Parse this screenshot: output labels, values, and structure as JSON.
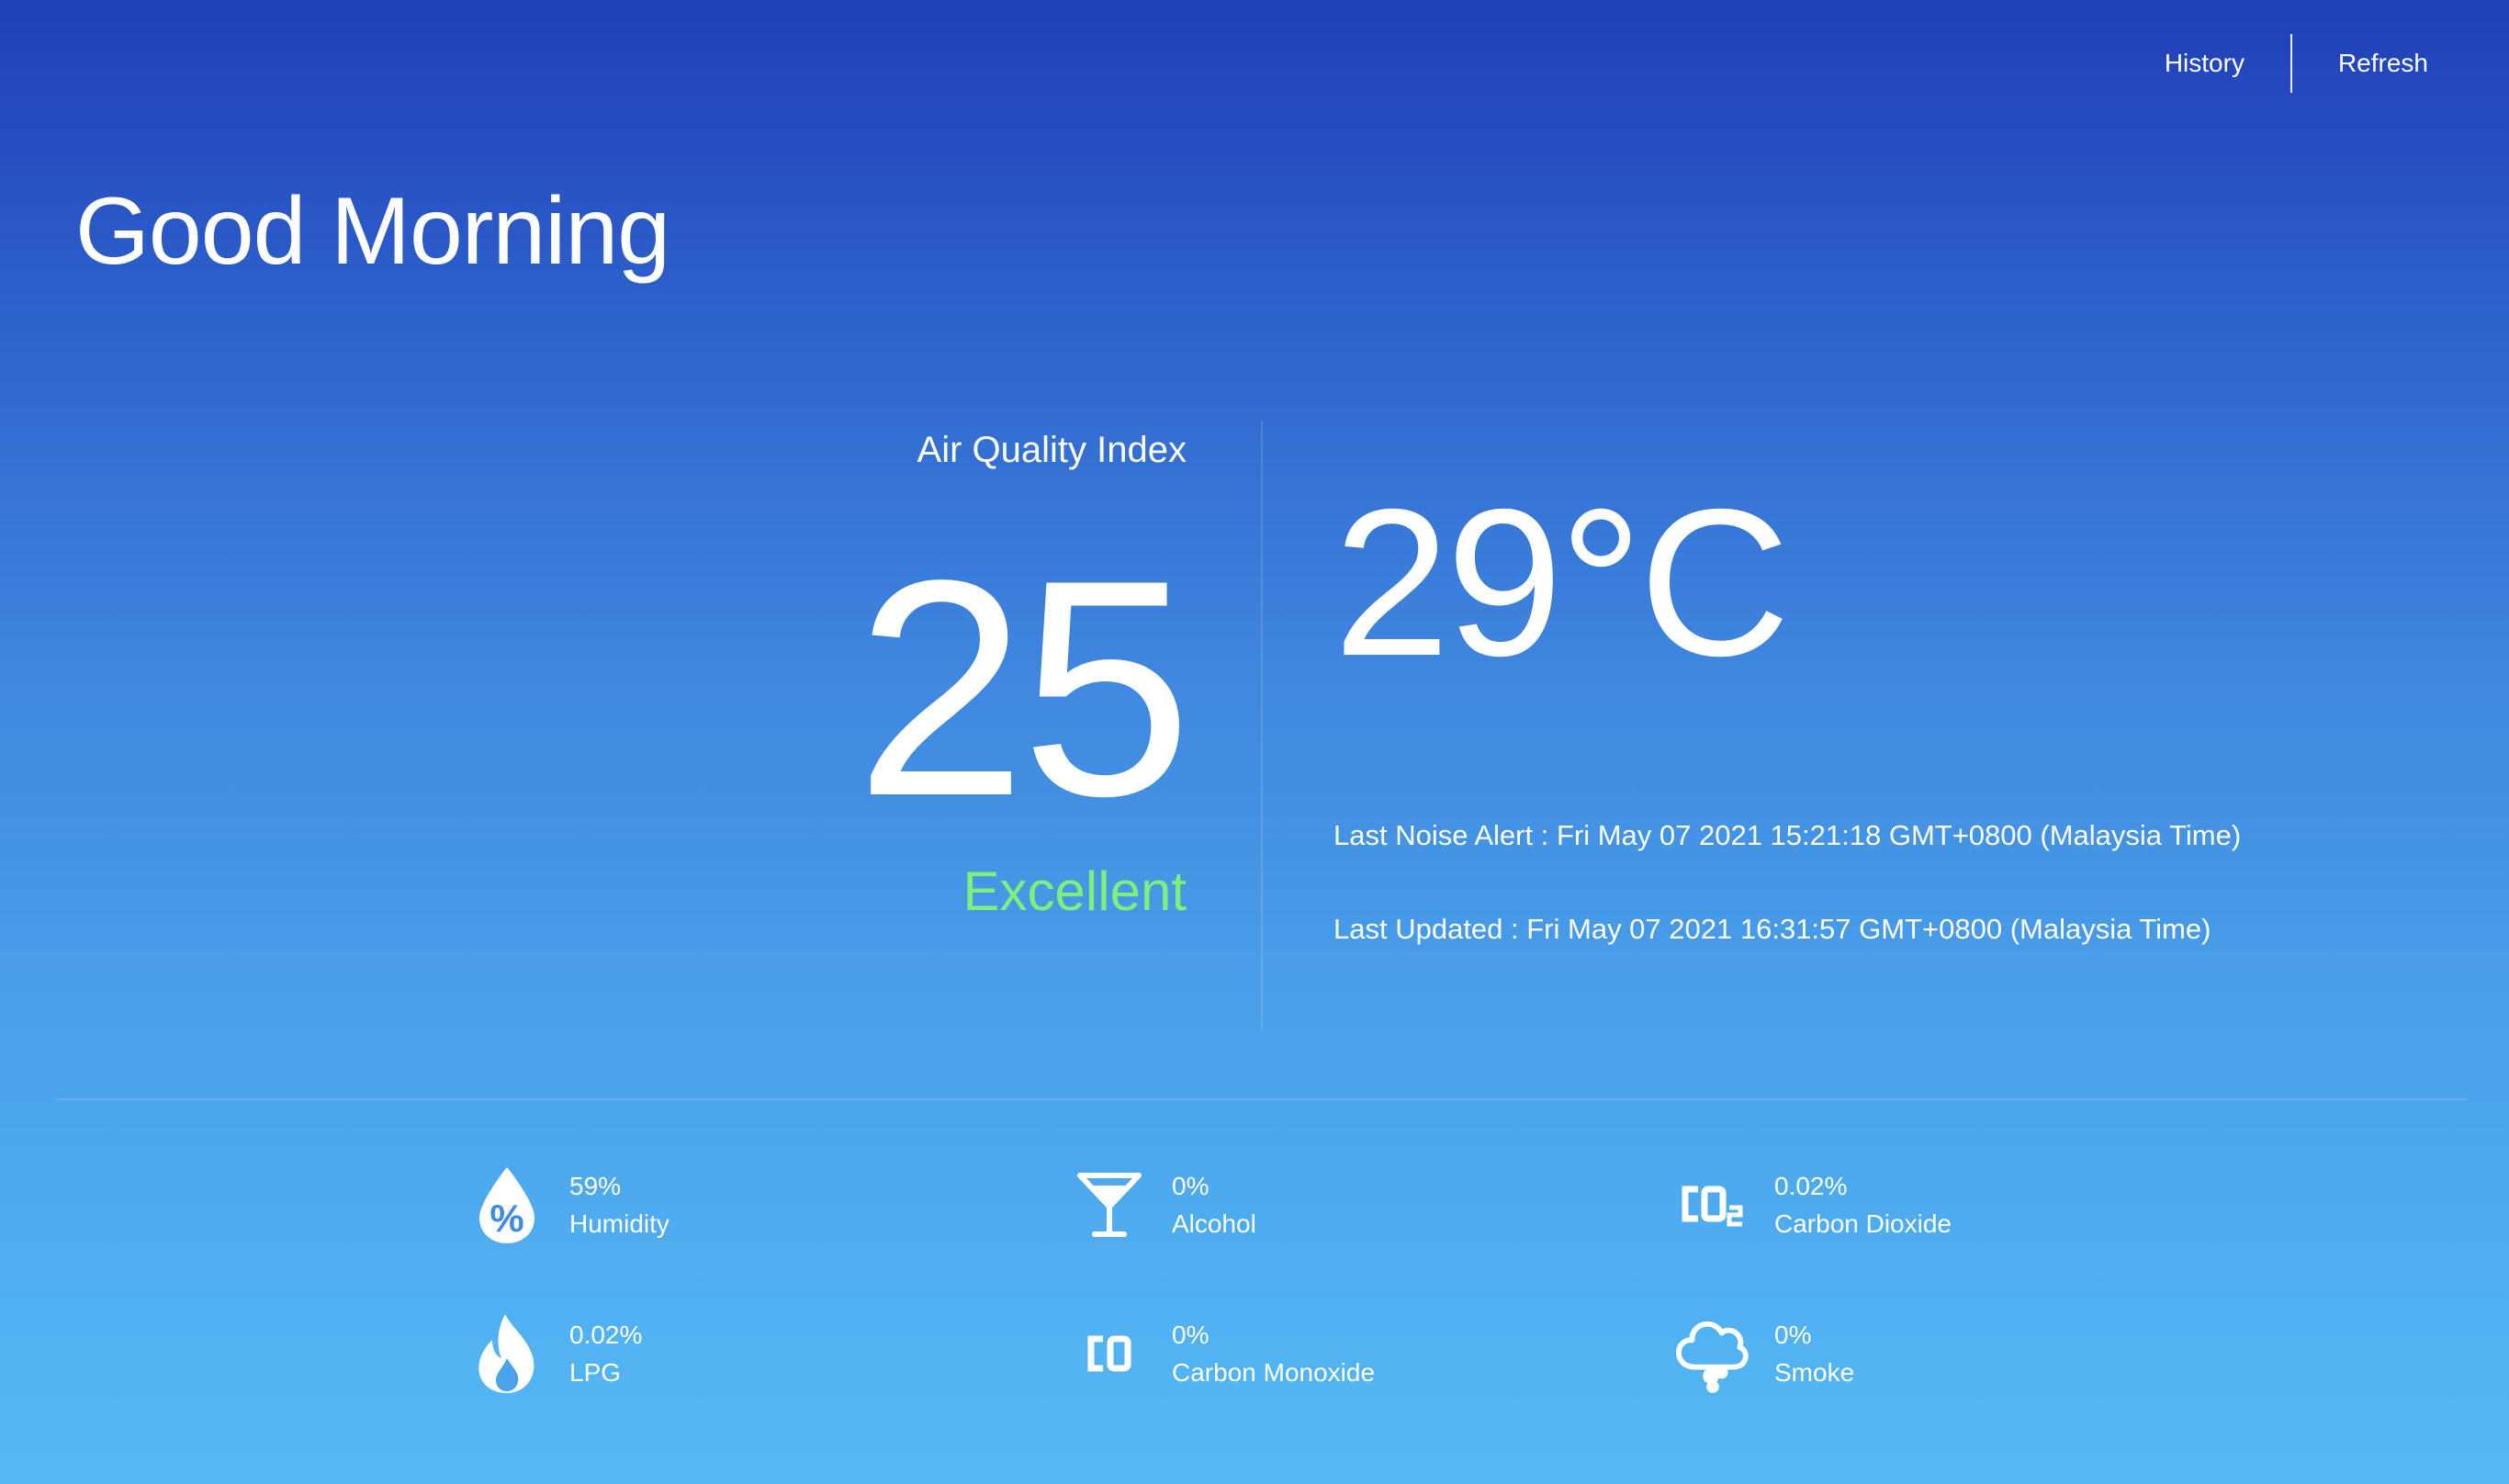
{
  "nav": {
    "history_label": "History",
    "refresh_label": "Refresh"
  },
  "greeting": "Good Morning",
  "aqi": {
    "label": "Air Quality Index",
    "value": "25",
    "status": "Excellent",
    "status_color": "#7cf07a"
  },
  "temperature": "29°C",
  "noise_alert": "Last Noise Alert : Fri May 07 2021 15:21:18 GMT+0800 (Malaysia Time)",
  "last_updated": "Last Updated : Fri May 07 2021 16:31:57 GMT+0800 (Malaysia Time)",
  "sensors": [
    {
      "value": "59%",
      "label": "Humidity",
      "icon": "humidity-drop-icon"
    },
    {
      "value": "0%",
      "label": "Alcohol",
      "icon": "cocktail-glass-icon"
    },
    {
      "value": "0.02%",
      "label": "Carbon Dioxide",
      "icon": "co2-icon"
    },
    {
      "value": "0.02%",
      "label": "LPG",
      "icon": "flame-icon"
    },
    {
      "value": "0%",
      "label": "Carbon Monoxide",
      "icon": "co-icon"
    },
    {
      "value": "0%",
      "label": "Smoke",
      "icon": "smoke-cloud-icon"
    }
  ],
  "colors": {
    "gradient_top": "#203fb8",
    "gradient_bottom": "#55b9f6",
    "text": "#ffffff"
  }
}
